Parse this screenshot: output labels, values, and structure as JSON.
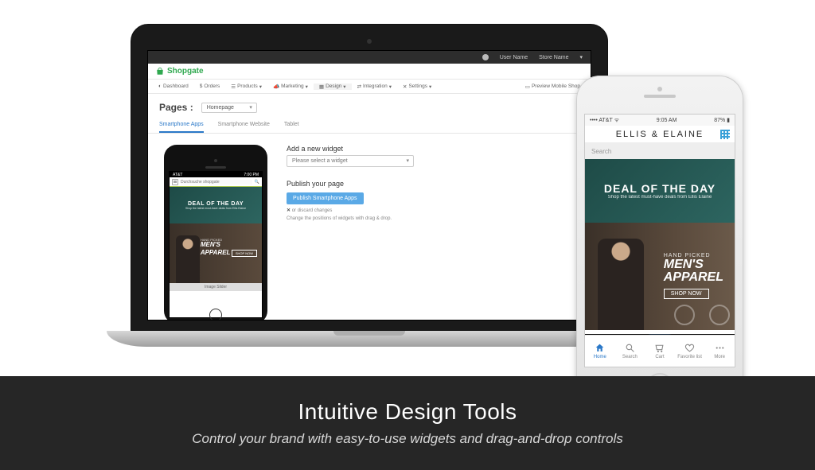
{
  "marketing": {
    "headline": "Intuitive Design Tools",
    "subline": "Control your brand with easy-to-use widgets and drag-and-drop controls"
  },
  "laptop": {
    "topbar": {
      "user": "User Name",
      "store": "Store Name"
    },
    "brand": "Shopgate",
    "nav": {
      "dashboard": "Dashboard",
      "orders": "Orders",
      "products": "Products",
      "marketing": "Marketing",
      "design": "Design",
      "integration": "Integration",
      "settings": "Settings",
      "preview": "Preview Mobile Shop"
    },
    "pages_label": "Pages :",
    "page_selected": "Homepage",
    "tabs": {
      "apps": "Smartphone Apps",
      "web": "Smartphone Website",
      "tablet": "Tablet"
    },
    "preview": {
      "carrier": "AT&T",
      "time": "7:00 PM",
      "search_placeholder": "Durchsuche shopgate",
      "deal_title": "DEAL OF THE DAY",
      "deal_sub": "Shop the latest must-have deals from Ellis Elaine",
      "mens_small": "HAND PICKED",
      "mens_big": "MEN'S\nAPPAREL",
      "mens_btn": "SHOP NOW",
      "slider_label": "Image Slider"
    },
    "right": {
      "add_title": "Add a new widget",
      "add_placeholder": "Please select a widget",
      "pub_title": "Publish your page",
      "pub_btn": "Publish Smartphone Apps",
      "discard_x": "✕",
      "discard": "or discard changes",
      "hint": "Change the positions of widgets with drag & drop."
    }
  },
  "phone": {
    "status": {
      "carrier": "AT&T",
      "time": "9:05 AM",
      "battery": "87%"
    },
    "brand": "ELLIS & ELAINE",
    "search_placeholder": "Search",
    "deal_title": "DEAL OF THE DAY",
    "deal_sub": "Shop the latest must-have deals from Ellis Elaine",
    "mens_small": "HAND PICKED",
    "mens_big1": "MEN'S",
    "mens_big2": "APPAREL",
    "mens_btn": "SHOP NOW",
    "tabs": {
      "home": "Home",
      "search": "Search",
      "cart": "Cart",
      "fav": "Favorite list",
      "more": "More"
    }
  }
}
